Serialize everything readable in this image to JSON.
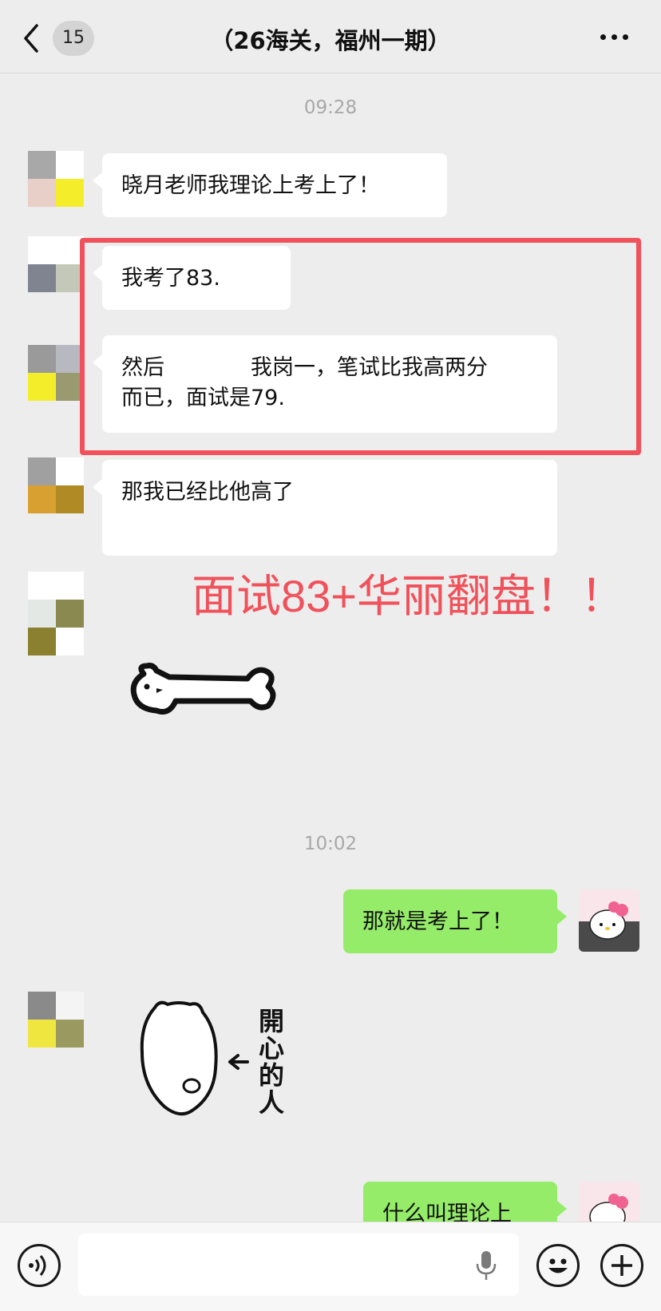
{
  "header": {
    "back_icon": "chevron-left-icon",
    "unread_count": "15",
    "title": "（26海关，福州一期）",
    "more_icon": "more-dots-icon"
  },
  "messages": {
    "time_1": "09:28",
    "msg_1": "晓月老师我理论上考上了！",
    "msg_2": "我考了83.",
    "msg_3_line1": "然后　　　　我岗一，笔试比我高两分",
    "msg_3_line2": "而已，面试是79.",
    "msg_4": "那我已经比他高了",
    "time_2": "10:02",
    "msg_5": "那就是考上了！",
    "sticker_text": [
      "開",
      "心",
      "的",
      "人"
    ],
    "msg_6": "什么叫理论上"
  },
  "annotation": {
    "text": "面试83+华丽翻盘！！",
    "color": "#f0515a"
  },
  "input_bar": {
    "voice_icon": "voice-icon",
    "mic_icon": "microphone-icon",
    "emoji_icon": "emoji-icon",
    "plus_icon": "plus-icon"
  },
  "colors": {
    "background": "#ededed",
    "sent_bubble": "#95ec69",
    "received_bubble": "#ffffff"
  }
}
